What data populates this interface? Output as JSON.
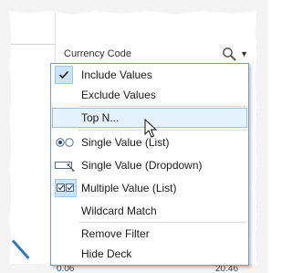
{
  "header": {
    "title": "Currency Code",
    "search_icon": "search-icon",
    "menu_icon": "chevron-down-icon"
  },
  "menu": {
    "items": [
      {
        "label": "Include Values",
        "icon": "checkmark-icon",
        "checked": true
      },
      {
        "label": "Exclude Values",
        "icon": null
      },
      {
        "label": "Top N...",
        "icon": null,
        "hovered": true
      },
      {
        "label": "Single Value (List)",
        "icon": "radio-list-icon"
      },
      {
        "label": "Single Value (Dropdown)",
        "icon": "dropdown-list-icon"
      },
      {
        "label": "Multiple Value (List)",
        "icon": "multi-check-icon",
        "checked": true
      },
      {
        "label": "Wildcard Match",
        "icon": null
      },
      {
        "label": "Remove Filter",
        "icon": null
      },
      {
        "label": "Hide Deck",
        "icon": null
      }
    ]
  },
  "colors": {
    "menu_border": "#7a9cc4",
    "hover_bg": "#e5f1fb",
    "check_bg": "#cce4f7",
    "accent_stroke": "#2b7bb9"
  }
}
